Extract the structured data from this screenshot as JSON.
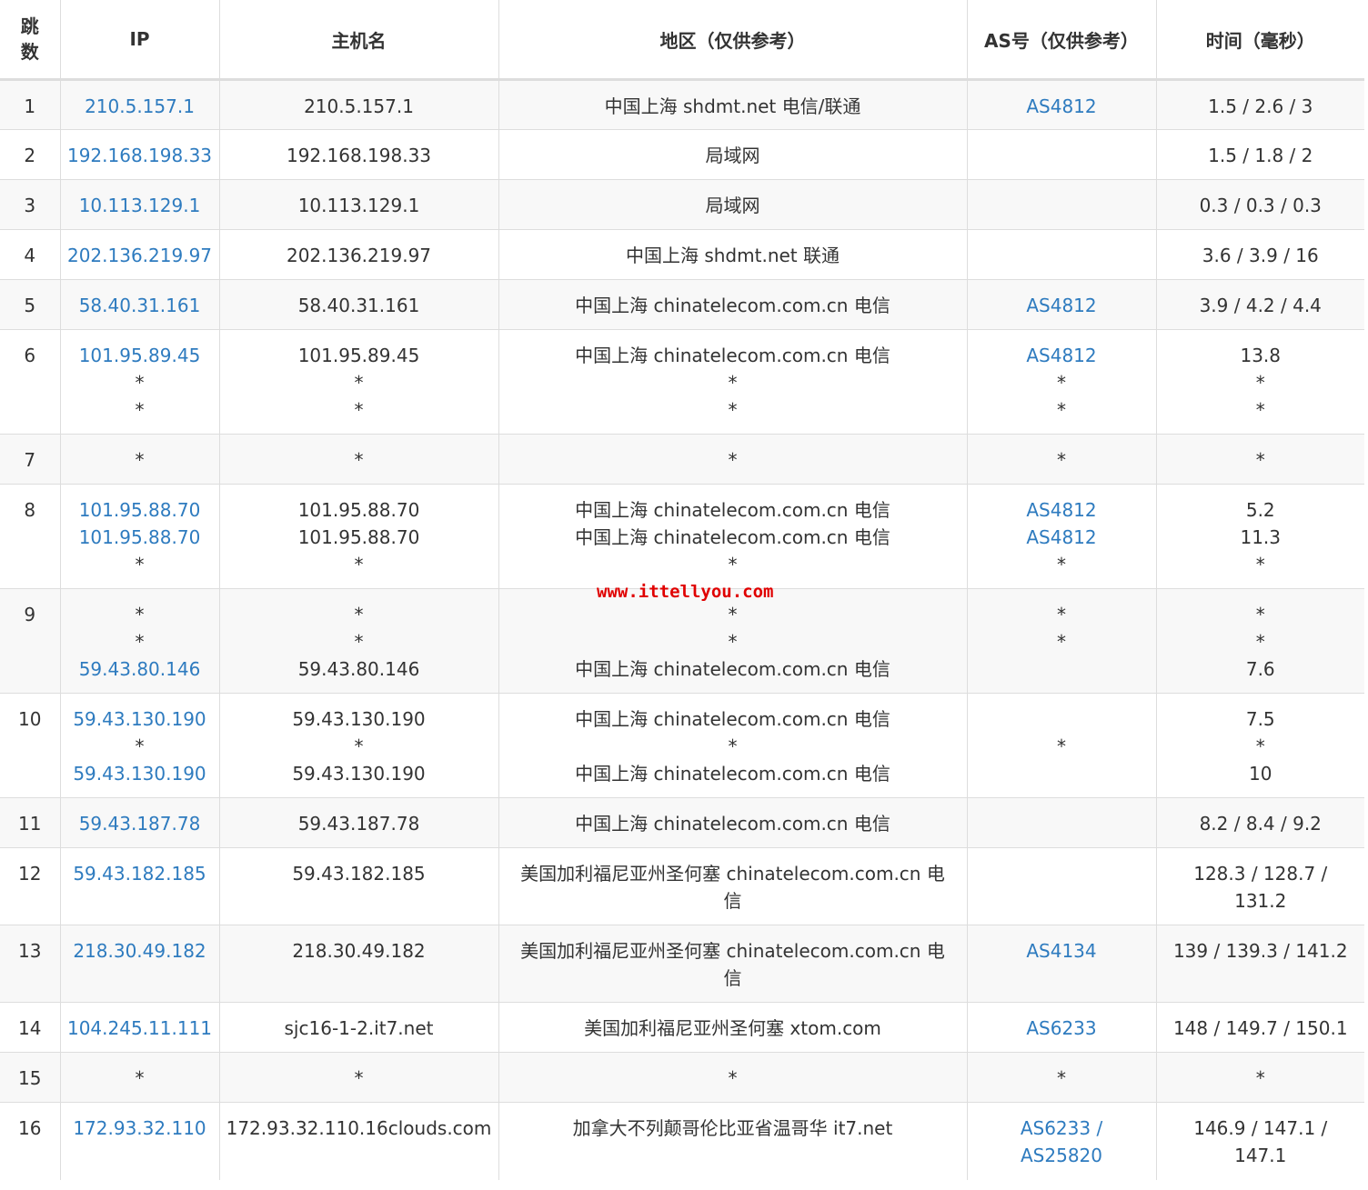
{
  "headers": {
    "hop_line1": "跳",
    "hop_line2": "数",
    "ip": "IP",
    "hostname": "主机名",
    "region": "地区（仅供参考）",
    "as": "AS号（仅供参考）",
    "time": "时间（毫秒）"
  },
  "watermark": "www.ittellyou.com",
  "rows": [
    {
      "hop": "1",
      "ip": [
        "210.5.157.1"
      ],
      "host": [
        "210.5.157.1"
      ],
      "region": [
        "中国上海 shdmt.net 电信/联通"
      ],
      "as": [
        "AS4812"
      ],
      "time": [
        "1.5 / 2.6 / 3"
      ]
    },
    {
      "hop": "2",
      "ip": [
        "192.168.198.33"
      ],
      "host": [
        "192.168.198.33"
      ],
      "region": [
        "局域网"
      ],
      "as": [
        ""
      ],
      "time": [
        "1.5 / 1.8 / 2"
      ]
    },
    {
      "hop": "3",
      "ip": [
        "10.113.129.1"
      ],
      "host": [
        "10.113.129.1"
      ],
      "region": [
        "局域网"
      ],
      "as": [
        ""
      ],
      "time": [
        "0.3 / 0.3 / 0.3"
      ]
    },
    {
      "hop": "4",
      "ip": [
        "202.136.219.97"
      ],
      "host": [
        "202.136.219.97"
      ],
      "region": [
        "中国上海 shdmt.net 联通"
      ],
      "as": [
        ""
      ],
      "time": [
        "3.6 / 3.9 / 16"
      ]
    },
    {
      "hop": "5",
      "ip": [
        "58.40.31.161"
      ],
      "host": [
        "58.40.31.161"
      ],
      "region": [
        "中国上海 chinatelecom.com.cn 电信"
      ],
      "as": [
        "AS4812"
      ],
      "time": [
        "3.9 / 4.2 / 4.4"
      ]
    },
    {
      "hop": "6",
      "ip": [
        "101.95.89.45",
        "*",
        "*"
      ],
      "host": [
        "101.95.89.45",
        "*",
        "*"
      ],
      "region": [
        "中国上海 chinatelecom.com.cn 电信",
        "*",
        "*"
      ],
      "as": [
        "AS4812",
        "*",
        "*"
      ],
      "time": [
        "13.8",
        "*",
        "*"
      ]
    },
    {
      "hop": "7",
      "ip": [
        "*"
      ],
      "host": [
        "*"
      ],
      "region": [
        "*"
      ],
      "as": [
        "*"
      ],
      "time": [
        "*"
      ]
    },
    {
      "hop": "8",
      "ip": [
        "101.95.88.70",
        "101.95.88.70",
        "*"
      ],
      "host": [
        "101.95.88.70",
        "101.95.88.70",
        "*"
      ],
      "region": [
        "中国上海 chinatelecom.com.cn 电信",
        "中国上海 chinatelecom.com.cn 电信",
        "*"
      ],
      "as": [
        "AS4812",
        "AS4812",
        "*"
      ],
      "time": [
        "5.2",
        "11.3",
        "*"
      ]
    },
    {
      "hop": "9",
      "ip": [
        "*",
        "*",
        "59.43.80.146"
      ],
      "host": [
        "*",
        "*",
        "59.43.80.146"
      ],
      "region": [
        "*",
        "*",
        "中国上海 chinatelecom.com.cn 电信"
      ],
      "as": [
        "*",
        "*",
        ""
      ],
      "time": [
        "*",
        "*",
        "7.6"
      ]
    },
    {
      "hop": "10",
      "ip": [
        "59.43.130.190",
        "*",
        "59.43.130.190"
      ],
      "host": [
        "59.43.130.190",
        "*",
        "59.43.130.190"
      ],
      "region": [
        "中国上海 chinatelecom.com.cn 电信",
        "*",
        "中国上海 chinatelecom.com.cn 电信"
      ],
      "as": [
        "",
        "*",
        ""
      ],
      "time": [
        "7.5",
        "*",
        "10"
      ]
    },
    {
      "hop": "11",
      "ip": [
        "59.43.187.78"
      ],
      "host": [
        "59.43.187.78"
      ],
      "region": [
        "中国上海 chinatelecom.com.cn 电信"
      ],
      "as": [
        ""
      ],
      "time": [
        "8.2 / 8.4 / 9.2"
      ]
    },
    {
      "hop": "12",
      "ip": [
        "59.43.182.185"
      ],
      "host": [
        "59.43.182.185"
      ],
      "region": [
        "美国加利福尼亚州圣何塞 chinatelecom.com.cn 电",
        "信"
      ],
      "as": [
        ""
      ],
      "time": [
        "128.3 / 128.7 /",
        "131.2"
      ]
    },
    {
      "hop": "13",
      "ip": [
        "218.30.49.182"
      ],
      "host": [
        "218.30.49.182"
      ],
      "region": [
        "美国加利福尼亚州圣何塞 chinatelecom.com.cn 电",
        "信"
      ],
      "as": [
        "AS4134"
      ],
      "time": [
        "139 / 139.3 / 141.2"
      ]
    },
    {
      "hop": "14",
      "ip": [
        "104.245.11.111"
      ],
      "host": [
        "sjc16-1-2.it7.net"
      ],
      "region": [
        "美国加利福尼亚州圣何塞 xtom.com"
      ],
      "as": [
        "AS6233"
      ],
      "time": [
        "148 / 149.7 / 150.1"
      ]
    },
    {
      "hop": "15",
      "ip": [
        "*"
      ],
      "host": [
        "*"
      ],
      "region": [
        "*"
      ],
      "as": [
        "*"
      ],
      "time": [
        "*"
      ]
    },
    {
      "hop": "16",
      "ip": [
        "172.93.32.110"
      ],
      "host": [
        "172.93.32.110.16clouds.com"
      ],
      "region": [
        "加拿大不列颠哥伦比亚省温哥华 it7.net"
      ],
      "as": [
        "AS6233 /",
        "AS25820"
      ],
      "time": [
        "146.9 / 147.1 /",
        "147.1"
      ]
    }
  ],
  "colors": {
    "link": "#2e7bbf",
    "watermark": "#e00000",
    "border": "#dddddd",
    "stripe": "#f8f8f8"
  }
}
